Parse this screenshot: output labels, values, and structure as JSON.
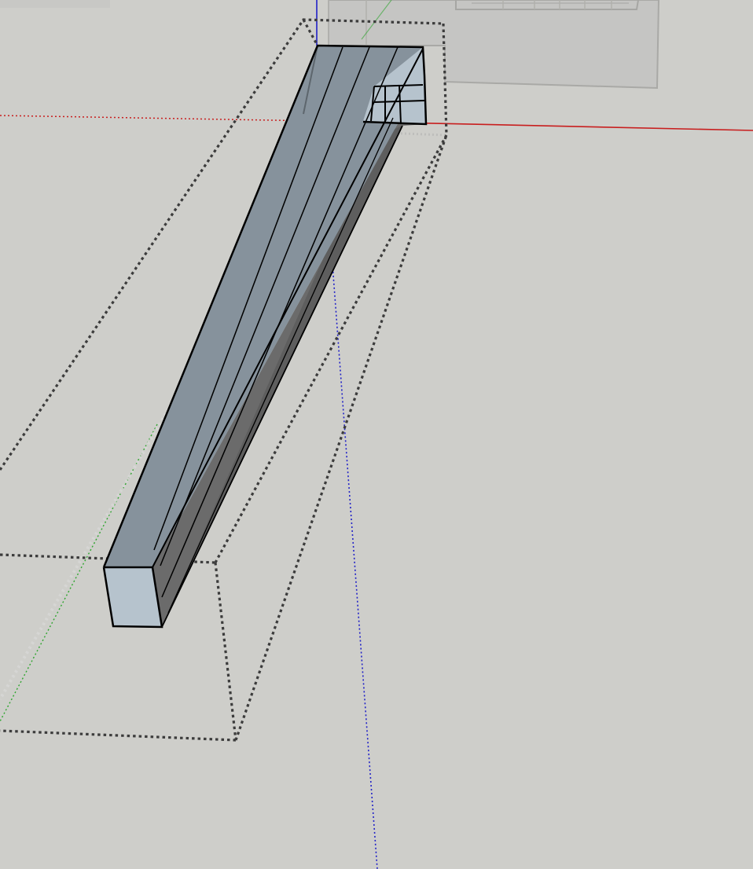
{
  "app": {
    "view": "3d-modeling-viewport",
    "background_color": "#cececa"
  },
  "scene": {
    "axes": {
      "red_axis_color": "#c81e1e",
      "green_axis_color": "#2fa52f",
      "blue_axis_color": "#2020c8"
    },
    "selected_object": {
      "type": "component",
      "selection_state": "selected",
      "top_face_color": "#86929c",
      "side_face_color": "#6a6a6a",
      "end_face_color": "#b6c3cd",
      "edge_color": "#000000"
    },
    "bounding_box": {
      "style": "dotted",
      "color": "#3c3c3c"
    },
    "background_object": {
      "type": "translucent-box",
      "color": "#c4c4c2"
    }
  }
}
